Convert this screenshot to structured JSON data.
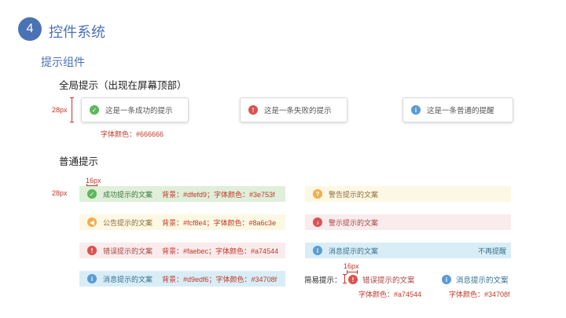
{
  "header": {
    "step": "4",
    "title": "控件系统",
    "section": "提示组件"
  },
  "global": {
    "title": "全局提示（出现在屏幕顶部）",
    "height_label": "28px",
    "toasts": [
      {
        "type": "success",
        "icon": "check-circle-icon",
        "text": "这是一条成功的提示",
        "color": "#5cb85c"
      },
      {
        "type": "error",
        "icon": "exclamation-circle-icon",
        "text": "这是一条失败的提示",
        "color": "#d9534f"
      },
      {
        "type": "info",
        "icon": "info-circle-icon",
        "text": "这是一条普通的提醒",
        "color": "#5b9bd5"
      }
    ],
    "font_note": "字体颜色：#666666"
  },
  "normal": {
    "title": "普通提示",
    "height_label": "28px",
    "width_label": "16px",
    "alerts": [
      {
        "name": "success",
        "icon": "check-circle-icon",
        "text": "成功提示的文案",
        "spec": "背景：#dfefd9；字体颜色：#3e753f",
        "bg": "#dfefd9",
        "color": "#3e753f",
        "icon_color": "#5cb85c"
      },
      {
        "name": "warning",
        "icon": "question-circle-icon",
        "text": "警告提示的文案",
        "spec": "",
        "bg": "#fcf8e3",
        "color": "#8a6c3e",
        "icon_color": "#f0ad4e"
      },
      {
        "name": "notice",
        "icon": "speaker-icon",
        "text": "公告提示的文案",
        "spec": "背景：#fcf8e4；字体颜色：#8a6c3e",
        "bg": "#fcf8e4",
        "color": "#8a6c3e",
        "icon_color": "#f0ad4e"
      },
      {
        "name": "alarm",
        "icon": "bell-icon",
        "text": "警示提示的文案",
        "spec": "",
        "bg": "#faebec",
        "color": "#a74544",
        "icon_color": "#d9534f"
      },
      {
        "name": "error",
        "icon": "exclamation-circle-icon",
        "text": "错误提示的文案",
        "spec": "背景：#faebec；字体颜色：#a74544",
        "bg": "#faebec",
        "color": "#a74544",
        "icon_color": "#d9534f"
      },
      {
        "name": "info-closable",
        "icon": "info-circle-icon",
        "text": "消息提示的文案",
        "spec": "",
        "close": "不再提醒",
        "bg": "#d9edf6",
        "color": "#34708f",
        "icon_color": "#5b9bd5"
      },
      {
        "name": "info",
        "icon": "info-circle-icon",
        "text": "消息提示的文案",
        "spec": "背景：#d9edf6；字体颜色：#34708f",
        "bg": "#d9edf6",
        "color": "#34708f",
        "icon_color": "#5b9bd5"
      }
    ],
    "simple": {
      "label": "简易提示：",
      "width_label": "16px",
      "error_text": "错误提示的文案",
      "error_note": "字体颜色：#a74544",
      "info_text": "消息提示的文案",
      "info_note": "字体颜色：#34708f"
    }
  }
}
